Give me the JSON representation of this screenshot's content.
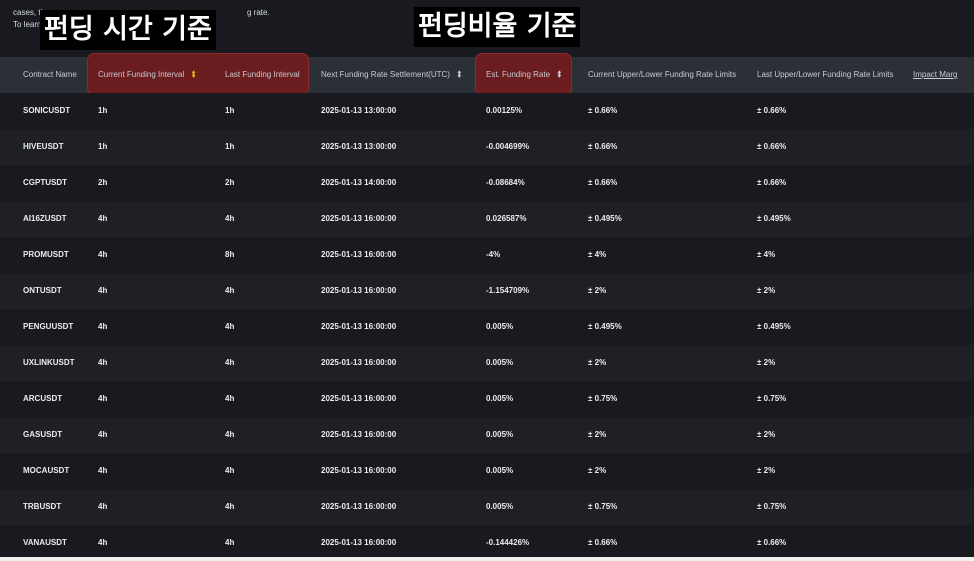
{
  "intro": {
    "line1_start": "cases, th",
    "line1_end": "g rate.",
    "line2_start": "To learn"
  },
  "overlays": {
    "funding_time": "펀딩 시간 기준",
    "funding_rate": "펀딩비율 기준"
  },
  "headers": [
    "Contract Name",
    "Current Funding Interval",
    "Last Funding Interval",
    "Next Funding Rate Settlement(UTC)",
    "Est. Funding Rate",
    "Current Upper/Lower Funding Rate Limits",
    "Last Upper/Lower Funding Rate Limits",
    "Impact Marg"
  ],
  "sort_icon": "sort-updown-icon",
  "colors": {
    "highlight": "#6a1c1e",
    "accent": "#f0b90b",
    "background": "#181a20"
  },
  "rows": [
    [
      "SONICUSDT",
      "1h",
      "1h",
      "2025-01-13 13:00:00",
      "0.00125%",
      "± 0.66%",
      "± 0.66%"
    ],
    [
      "HIVEUSDT",
      "1h",
      "1h",
      "2025-01-13 13:00:00",
      "-0.004699%",
      "± 0.66%",
      "± 0.66%"
    ],
    [
      "CGPTUSDT",
      "2h",
      "2h",
      "2025-01-13 14:00:00",
      "-0.08684%",
      "± 0.66%",
      "± 0.66%"
    ],
    [
      "AI16ZUSDT",
      "4h",
      "4h",
      "2025-01-13 16:00:00",
      "0.026587%",
      "± 0.495%",
      "± 0.495%"
    ],
    [
      "PROMUSDT",
      "4h",
      "8h",
      "2025-01-13 16:00:00",
      "-4%",
      "± 4%",
      "± 4%"
    ],
    [
      "ONTUSDT",
      "4h",
      "4h",
      "2025-01-13 16:00:00",
      "-1.154709%",
      "± 2%",
      "± 2%"
    ],
    [
      "PENGUUSDT",
      "4h",
      "4h",
      "2025-01-13 16:00:00",
      "0.005%",
      "± 0.495%",
      "± 0.495%"
    ],
    [
      "UXLINKUSDT",
      "4h",
      "4h",
      "2025-01-13 16:00:00",
      "0.005%",
      "± 2%",
      "± 2%"
    ],
    [
      "ARCUSDT",
      "4h",
      "4h",
      "2025-01-13 16:00:00",
      "0.005%",
      "± 0.75%",
      "± 0.75%"
    ],
    [
      "GASUSDT",
      "4h",
      "4h",
      "2025-01-13 16:00:00",
      "0.005%",
      "± 2%",
      "± 2%"
    ],
    [
      "MOCAUSDT",
      "4h",
      "4h",
      "2025-01-13 16:00:00",
      "0.005%",
      "± 2%",
      "± 2%"
    ],
    [
      "TRBUSDT",
      "4h",
      "4h",
      "2025-01-13 16:00:00",
      "0.005%",
      "± 0.75%",
      "± 0.75%"
    ],
    [
      "VANAUSDT",
      "4h",
      "4h",
      "2025-01-13 16:00:00",
      "-0.144426%",
      "± 0.66%",
      "± 0.66%"
    ]
  ]
}
